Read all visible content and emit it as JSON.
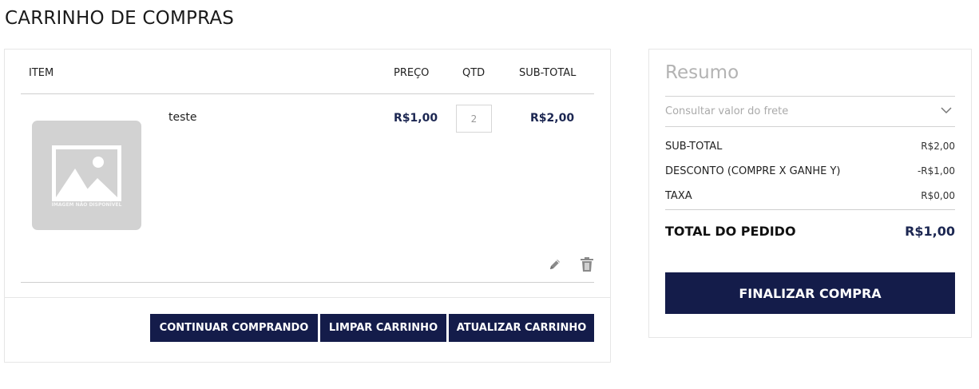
{
  "page": {
    "title": "CARRINHO DE COMPRAS"
  },
  "cart": {
    "headers": {
      "item": "ITEM",
      "price": "PREÇO",
      "qty": "QTD",
      "subtotal": "SUB-TOTAL"
    },
    "items": [
      {
        "name": "teste",
        "image_caption": "IMAGEM NÃO DISPONÍVEL",
        "price": "R$1,00",
        "qty_value": "2",
        "subtotal": "R$2,00"
      }
    ],
    "actions": {
      "continue_label": "CONTINUAR COMPRANDO",
      "clear_label": "LIMPAR CARRINHO",
      "update_label": "ATUALIZAR CARRINHO"
    }
  },
  "summary": {
    "title": "Resumo",
    "shipping_label": "Consultar valor do frete",
    "rows": [
      {
        "label": "SUB-TOTAL",
        "value": "R$2,00"
      },
      {
        "label": "DESCONTO (COMPRE X GANHE Y)",
        "value": "-R$1,00"
      },
      {
        "label": "TAXA",
        "value": "R$0,00"
      }
    ],
    "total_label": "TOTAL DO PEDIDO",
    "total_value": "R$1,00",
    "checkout_label": "FINALIZAR COMPRA"
  },
  "icons": {
    "edit": "pencil-icon",
    "delete": "trash-icon",
    "dropdown": "chevron-down-icon",
    "placeholder": "image-placeholder-icon"
  },
  "colors": {
    "primary": "#141c4a",
    "price_text": "#1c2752",
    "muted": "#b3b3b3"
  }
}
